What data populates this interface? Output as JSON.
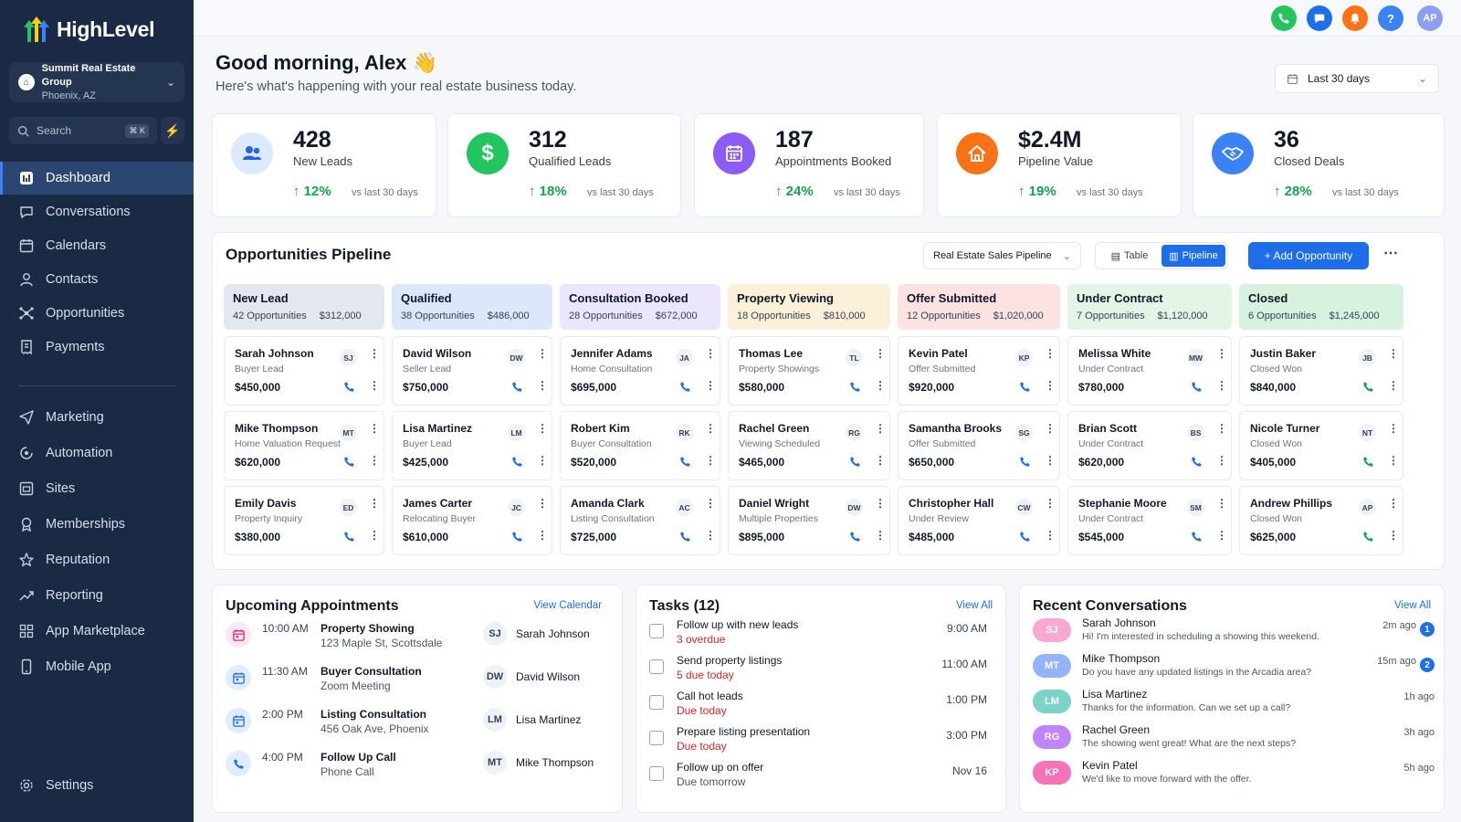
{
  "app": {
    "name": "HighLevel"
  },
  "account": {
    "name": "Summit Real Estate Group",
    "location": "Phoenix, AZ",
    "icon": "home-icon"
  },
  "search": {
    "placeholder": "Search",
    "shortcut": "⌘ K"
  },
  "nav": {
    "main": [
      {
        "label": "Dashboard",
        "icon": "dashboard-icon",
        "active": true
      },
      {
        "label": "Conversations",
        "icon": "chat-icon"
      },
      {
        "label": "Calendars",
        "icon": "calendar-icon"
      },
      {
        "label": "Contacts",
        "icon": "user-icon"
      },
      {
        "label": "Opportunities",
        "icon": "network-icon"
      },
      {
        "label": "Payments",
        "icon": "receipt-icon"
      }
    ],
    "secondary": [
      {
        "label": "Marketing",
        "icon": "send-icon"
      },
      {
        "label": "Automation",
        "icon": "automation-icon"
      },
      {
        "label": "Sites",
        "icon": "sites-icon"
      },
      {
        "label": "Memberships",
        "icon": "membership-icon"
      },
      {
        "label": "Reputation",
        "icon": "star-icon"
      },
      {
        "label": "Reporting",
        "icon": "trend-icon"
      },
      {
        "label": "App Marketplace",
        "icon": "grid-icon"
      },
      {
        "label": "Mobile App",
        "icon": "mobile-icon"
      }
    ],
    "settings": {
      "label": "Settings",
      "icon": "gear-icon"
    }
  },
  "topbar": {
    "avatar": "AP",
    "colors": {
      "phone": "#22c55e",
      "chat": "#1d6ee8",
      "bell": "#f97316",
      "help": "#3b82f6",
      "avatar": "#8b9ef0"
    }
  },
  "greeting": {
    "title": "Good morning, Alex",
    "wave": "👋",
    "subtitle": "Here's what's happening with your real estate business today."
  },
  "date_range": {
    "label": "Last 30 days"
  },
  "stats": [
    {
      "value": "428",
      "label": "New Leads",
      "change": "12%",
      "note": "vs last 30 days",
      "icon": "users-icon",
      "color": "#dbeafe"
    },
    {
      "value": "312",
      "label": "Qualified Leads",
      "change": "18%",
      "note": "vs last 30 days",
      "icon": "dollar-icon",
      "color": "#22c55e"
    },
    {
      "value": "187",
      "label": "Appointments Booked",
      "change": "24%",
      "note": "vs last 30 days",
      "icon": "calendar-icon",
      "color": "#8b5cf6"
    },
    {
      "value": "$2.4M",
      "label": "Pipeline Value",
      "change": "19%",
      "note": "vs last 30 days",
      "icon": "house-icon",
      "color": "#f97316"
    },
    {
      "value": "36",
      "label": "Closed Deals",
      "change": "28%",
      "note": "vs last 30 days",
      "icon": "handshake-icon",
      "color": "#3b82f6"
    }
  ],
  "pipeline": {
    "title": "Opportunities Pipeline",
    "selector": "Real Estate Sales Pipeline",
    "view_table": "Table",
    "view_pipeline": "Pipeline",
    "add_label": "+ Add Opportunity",
    "stages": [
      {
        "name": "New Lead",
        "count": "42 Opportunities",
        "total": "$312,000",
        "color": "#e3e8f0",
        "cards": [
          {
            "name": "Sarah Johnson",
            "stage": "Buyer Lead",
            "value": "$450,000",
            "initials": "SJ"
          },
          {
            "name": "Mike Thompson",
            "stage": "Home Valuation Request",
            "value": "$620,000",
            "initials": "MT"
          },
          {
            "name": "Emily Davis",
            "stage": "Property Inquiry",
            "value": "$380,000",
            "initials": "ED"
          }
        ]
      },
      {
        "name": "Qualified",
        "count": "38 Opportunities",
        "total": "$486,000",
        "color": "#dbe8fc",
        "cards": [
          {
            "name": "David Wilson",
            "stage": "Seller Lead",
            "value": "$750,000",
            "initials": "DW"
          },
          {
            "name": "Lisa Martinez",
            "stage": "Buyer Lead",
            "value": "$425,000",
            "initials": "LM"
          },
          {
            "name": "James Carter",
            "stage": "Relocating Buyer",
            "value": "$610,000",
            "initials": "JC"
          }
        ]
      },
      {
        "name": "Consultation Booked",
        "count": "28 Opportunities",
        "total": "$672,000",
        "color": "#ebe6fb",
        "cards": [
          {
            "name": "Jennifer Adams",
            "stage": "Home Consultation",
            "value": "$695,000",
            "initials": "JA"
          },
          {
            "name": "Robert Kim",
            "stage": "Buyer Consultation",
            "value": "$520,000",
            "initials": "RK"
          },
          {
            "name": "Amanda Clark",
            "stage": "Listing Consultation",
            "value": "$725,000",
            "initials": "AC"
          }
        ]
      },
      {
        "name": "Property Viewing",
        "count": "18 Opportunities",
        "total": "$810,000",
        "color": "#fdf0d8",
        "cards": [
          {
            "name": "Thomas Lee",
            "stage": "Property Showings",
            "value": "$580,000",
            "initials": "TL"
          },
          {
            "name": "Rachel Green",
            "stage": "Viewing Scheduled",
            "value": "$465,000",
            "initials": "RG"
          },
          {
            "name": "Daniel Wright",
            "stage": "Multiple Properties",
            "value": "$895,000",
            "initials": "DW"
          }
        ]
      },
      {
        "name": "Offer Submitted",
        "count": "12 Opportunities",
        "total": "$1,020,000",
        "color": "#fde2e2",
        "cards": [
          {
            "name": "Kevin Patel",
            "stage": "Offer Submitted",
            "value": "$920,000",
            "initials": "KP"
          },
          {
            "name": "Samantha Brooks",
            "stage": "Offer Submitted",
            "value": "$650,000",
            "initials": "SG"
          },
          {
            "name": "Christopher Hall",
            "stage": "Under Review",
            "value": "$485,000",
            "initials": "CW"
          }
        ]
      },
      {
        "name": "Under Contract",
        "count": "7 Opportunities",
        "total": "$1,120,000",
        "color": "#e2f5e6",
        "cards": [
          {
            "name": "Melissa White",
            "stage": "Under Contract",
            "value": "$780,000",
            "initials": "MW"
          },
          {
            "name": "Brian Scott",
            "stage": "Under Contract",
            "value": "$620,000",
            "initials": "BS"
          },
          {
            "name": "Stephanie Moore",
            "stage": "Under Contract",
            "value": "$545,000",
            "initials": "SM"
          }
        ]
      },
      {
        "name": "Closed",
        "count": "6 Opportunities",
        "total": "$1,245,000",
        "color": "#d7f2df",
        "cards": [
          {
            "name": "Justin Baker",
            "stage": "Closed Won",
            "value": "$840,000",
            "initials": "JB"
          },
          {
            "name": "Nicole Turner",
            "stage": "Closed Won",
            "value": "$405,000",
            "initials": "NT"
          },
          {
            "name": "Andrew Phillips",
            "stage": "Closed Won",
            "value": "$625,000",
            "initials": "AP"
          }
        ]
      }
    ]
  },
  "appointments": {
    "title": "Upcoming Appointments",
    "link": "View Calendar",
    "items": [
      {
        "time": "10:00 AM",
        "title": "Property Showing",
        "subtitle": "123 Maple St, Scottsdale",
        "initials": "SJ",
        "person": "Sarah Johnson",
        "icon": "calendar-icon",
        "color": "#db2777"
      },
      {
        "time": "11:30 AM",
        "title": "Buyer Consultation",
        "subtitle": "Zoom Meeting",
        "initials": "DW",
        "person": "David Wilson",
        "icon": "calendar-icon",
        "color": "#1d6ee8"
      },
      {
        "time": "2:00 PM",
        "title": "Listing Consultation",
        "subtitle": "456 Oak Ave, Phoenix",
        "initials": "LM",
        "person": "Lisa Martinez",
        "icon": "calendar-icon",
        "color": "#1d6ee8"
      },
      {
        "time": "4:00 PM",
        "title": "Follow Up Call",
        "subtitle": "Phone Call",
        "initials": "MT",
        "person": "Mike Thompson",
        "icon": "phone-icon",
        "color": "#1d6ee8"
      }
    ]
  },
  "tasks": {
    "title": "Tasks (12)",
    "link": "View All",
    "items": [
      {
        "title": "Follow up with new leads",
        "status": "3 overdue",
        "time": "9:00 AM",
        "urgent": true
      },
      {
        "title": "Send property listings",
        "status": "5 due today",
        "time": "11:00 AM",
        "urgent": true
      },
      {
        "title": "Call hot leads",
        "status": "Due today",
        "time": "1:00 PM",
        "urgent": true
      },
      {
        "title": "Prepare listing presentation",
        "status": "Due today",
        "time": "3:00 PM",
        "urgent": true
      },
      {
        "title": "Follow up on offer",
        "status": "Due tomorrow",
        "time": "Nov 16",
        "urgent": false
      }
    ]
  },
  "conversations": {
    "title": "Recent Conversations",
    "link": "View All",
    "items": [
      {
        "initials": "SJ",
        "name": "Sarah Johnson",
        "message": "Hi! I'm interested in scheduling a showing this weekend.",
        "time": "2m ago",
        "badge": "1",
        "color": "#f9a8d4"
      },
      {
        "initials": "MT",
        "name": "Mike Thompson",
        "message": "Do you have any updated listings in the Arcadia area?",
        "time": "15m ago",
        "badge": "2",
        "color": "#93b4f6"
      },
      {
        "initials": "LM",
        "name": "Lisa Martinez",
        "message": "Thanks for the information. Can we set up a call?",
        "time": "1h ago",
        "badge": "",
        "color": "#7dd3c8"
      },
      {
        "initials": "RG",
        "name": "Rachel Green",
        "message": "The showing went great! What are the next steps?",
        "time": "3h ago",
        "badge": "",
        "color": "#c084fc"
      },
      {
        "initials": "KP",
        "name": "Kevin Patel",
        "message": "We'd like to move forward with the offer.",
        "time": "5h ago",
        "badge": "",
        "color": "#f472b6"
      }
    ]
  }
}
